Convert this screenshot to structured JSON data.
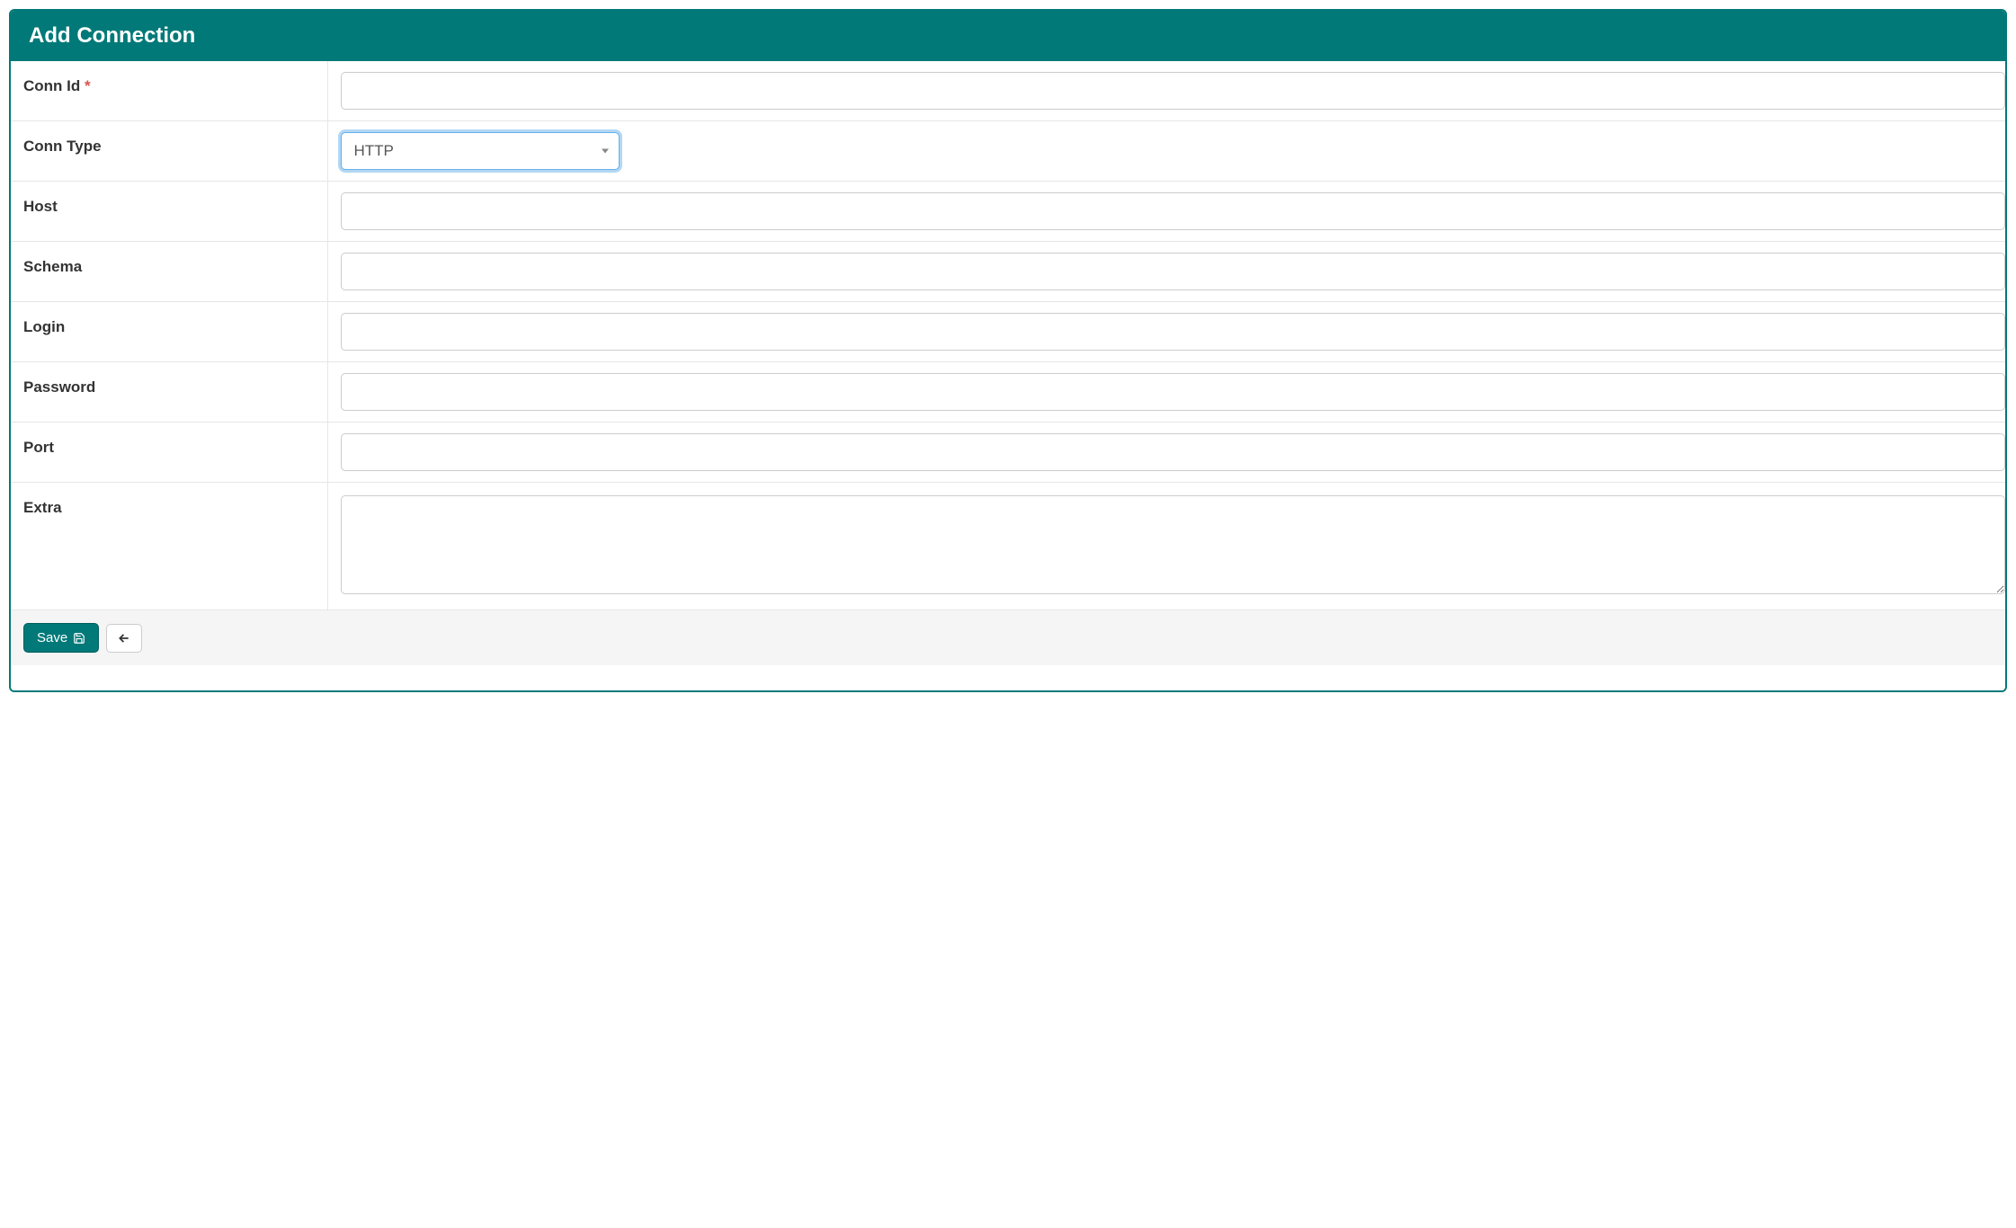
{
  "header": {
    "title": "Add Connection"
  },
  "form": {
    "fields": {
      "conn_id": {
        "label": "Conn Id",
        "required_marker": "*",
        "value": ""
      },
      "conn_type": {
        "label": "Conn Type",
        "selected": "HTTP"
      },
      "host": {
        "label": "Host",
        "value": ""
      },
      "schema": {
        "label": "Schema",
        "value": ""
      },
      "login": {
        "label": "Login",
        "value": ""
      },
      "password": {
        "label": "Password",
        "value": ""
      },
      "port": {
        "label": "Port",
        "value": ""
      },
      "extra": {
        "label": "Extra",
        "value": ""
      }
    }
  },
  "footer": {
    "save_label": "Save"
  }
}
